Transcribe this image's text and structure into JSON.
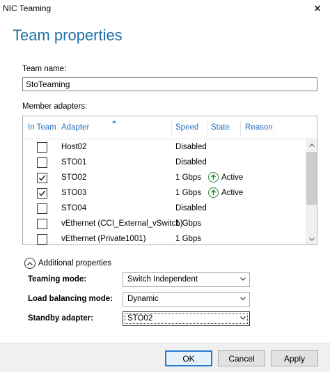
{
  "window": {
    "title": "NIC Teaming",
    "close_glyph": "✕"
  },
  "heading": "Team properties",
  "team_name": {
    "label": "Team name:",
    "value": "StoTeaming"
  },
  "member_adapters": {
    "label": "Member adapters:",
    "columns": {
      "in_team": "In Team",
      "adapter": "Adapter",
      "speed": "Speed",
      "state": "State",
      "reason": "Reason"
    },
    "rows": [
      {
        "checked": false,
        "adapter": "Host02",
        "speed": "Disabled",
        "state": "",
        "reason": ""
      },
      {
        "checked": false,
        "adapter": "STO01",
        "speed": "Disabled",
        "state": "",
        "reason": ""
      },
      {
        "checked": true,
        "adapter": "STO02",
        "speed": "1 Gbps",
        "state": "Active",
        "reason": ""
      },
      {
        "checked": true,
        "adapter": "STO03",
        "speed": "1 Gbps",
        "state": "Active",
        "reason": ""
      },
      {
        "checked": false,
        "adapter": "STO04",
        "speed": "Disabled",
        "state": "",
        "reason": ""
      },
      {
        "checked": false,
        "adapter": "vEthernet (CCI_External_vSwitch)",
        "speed": "1 Gbps",
        "state": "",
        "reason": ""
      },
      {
        "checked": false,
        "adapter": "vEthernet (Private1001)",
        "speed": "1 Gbps",
        "state": "",
        "reason": ""
      }
    ]
  },
  "additional_properties": {
    "toggle_label": "Additional properties",
    "teaming_mode": {
      "label": "Teaming mode:",
      "value": "Switch Independent"
    },
    "load_balancing_mode": {
      "label": "Load balancing mode:",
      "value": "Dynamic"
    },
    "standby_adapter": {
      "label": "Standby adapter:",
      "value": "STO02"
    }
  },
  "buttons": {
    "ok": "OK",
    "cancel": "Cancel",
    "apply": "Apply"
  },
  "colors": {
    "heading": "#1f6fa8",
    "column_header": "#2a6ebb",
    "active_status": "#2e8b3e",
    "default_button_border": "#2a7ad1"
  },
  "icons": {
    "close": "close-icon",
    "check": "checkmark-icon",
    "status": "up-arrow-circle-icon",
    "collapse": "chevron-up-circle-icon",
    "dropdown": "chevron-down-icon"
  }
}
